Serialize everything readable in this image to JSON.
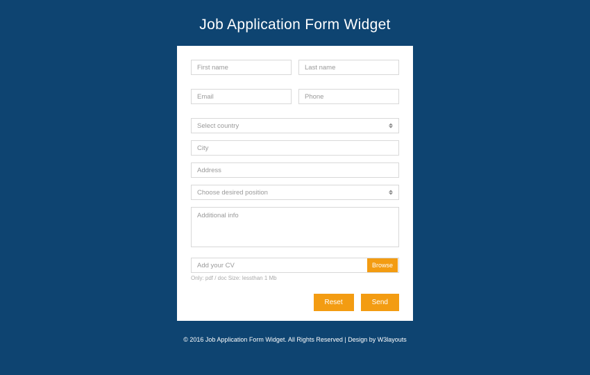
{
  "title": "Job Application Form Widget",
  "form": {
    "first_name_placeholder": "First name",
    "last_name_placeholder": "Last name",
    "email_placeholder": "Email",
    "phone_placeholder": "Phone",
    "country_placeholder": "Select country",
    "city_placeholder": "City",
    "address_placeholder": "Address",
    "position_placeholder": "Choose desired position",
    "additional_info_placeholder": "Additional info",
    "cv_label": "Add your CV",
    "browse_label": "Browse",
    "cv_hint": "Only: pdf / doc Size: lessthan 1 Mb",
    "reset_label": "Reset",
    "send_label": "Send"
  },
  "footer": "© 2016 Job Application Form Widget. All Rights Reserved | Design by W3layouts"
}
